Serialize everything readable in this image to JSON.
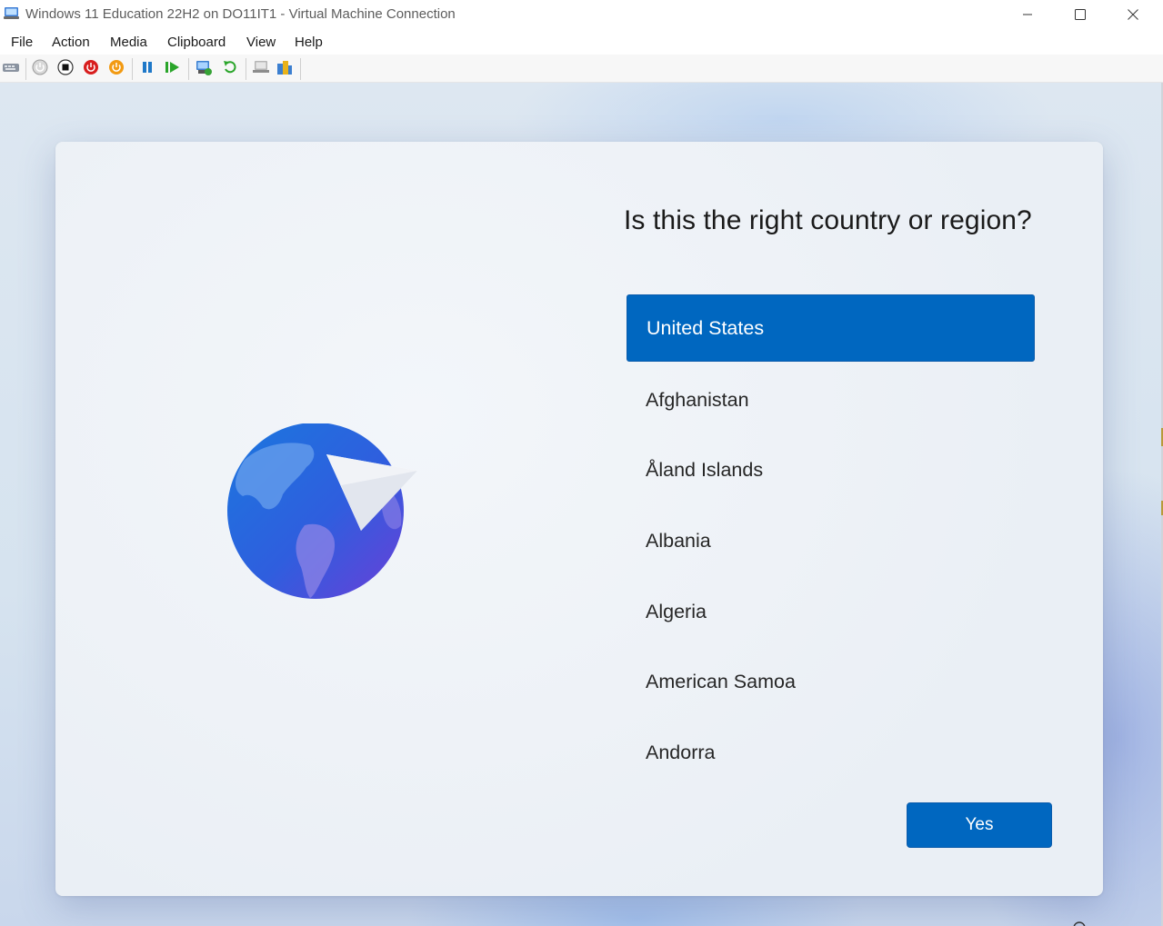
{
  "window": {
    "title": "Windows 11 Education 22H2 on DO11IT1 - Virtual Machine Connection",
    "icon": "hyper-v-vm-icon",
    "controls": [
      "minimize-icon",
      "maximize-icon",
      "close-icon"
    ]
  },
  "menu": {
    "items": [
      {
        "label": "File"
      },
      {
        "label": "Action"
      },
      {
        "label": "Media"
      },
      {
        "label": "Clipboard"
      },
      {
        "label": "View"
      },
      {
        "label": "Help"
      }
    ]
  },
  "toolbar": {
    "buttons": [
      "ctrl-alt-del-icon",
      "start-icon",
      "turn-off-icon",
      "shut-down-icon",
      "save-icon",
      "pause-icon",
      "resume-icon",
      "checkpoint-icon",
      "revert-icon",
      "enhanced-session-icon",
      "share-icon"
    ]
  },
  "oobe": {
    "question": "Is this the right country or region?",
    "countries": [
      {
        "label": "United States",
        "selected": true
      },
      {
        "label": "Afghanistan",
        "selected": false
      },
      {
        "label": "Åland Islands",
        "selected": false
      },
      {
        "label": "Albania",
        "selected": false
      },
      {
        "label": "Algeria",
        "selected": false
      },
      {
        "label": "American Samoa",
        "selected": false
      },
      {
        "label": "Andorra",
        "selected": false
      }
    ],
    "yes_label": "Yes",
    "accent_color": "#0067c0",
    "illustration": "globe-paper-plane-icon"
  }
}
